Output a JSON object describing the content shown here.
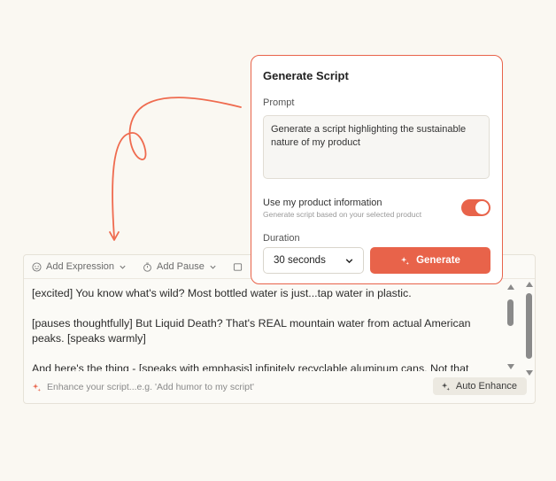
{
  "toolbar": {
    "add_expression": "Add Expression",
    "add_pause": "Add Pause"
  },
  "script": {
    "paragraph_1": "[excited] You know what's wild? Most bottled water is just...tap water in plastic.",
    "paragraph_2": "[pauses thoughtfully] But Liquid Death? That's REAL mountain water from actual American peaks. [speaks warmly]",
    "paragraph_3": "And here's the thing - [speaks with emphasis] infinitely recyclable aluminum cans. Not that"
  },
  "enhance": {
    "placeholder": "Enhance your script...e.g. 'Add humor to my script'",
    "button_label": "Auto Enhance"
  },
  "popover": {
    "title": "Generate Script",
    "prompt_label": "Prompt",
    "prompt_value": "Generate a script highlighting the sustainable nature of my product",
    "toggle_label": "Use my product information",
    "toggle_subtitle": "Generate script based on your selected product",
    "toggle_on": true,
    "duration_label": "Duration",
    "duration_value": "30 seconds",
    "generate_label": "Generate"
  },
  "colors": {
    "accent": "#e8634a",
    "background": "#faf8f2"
  }
}
